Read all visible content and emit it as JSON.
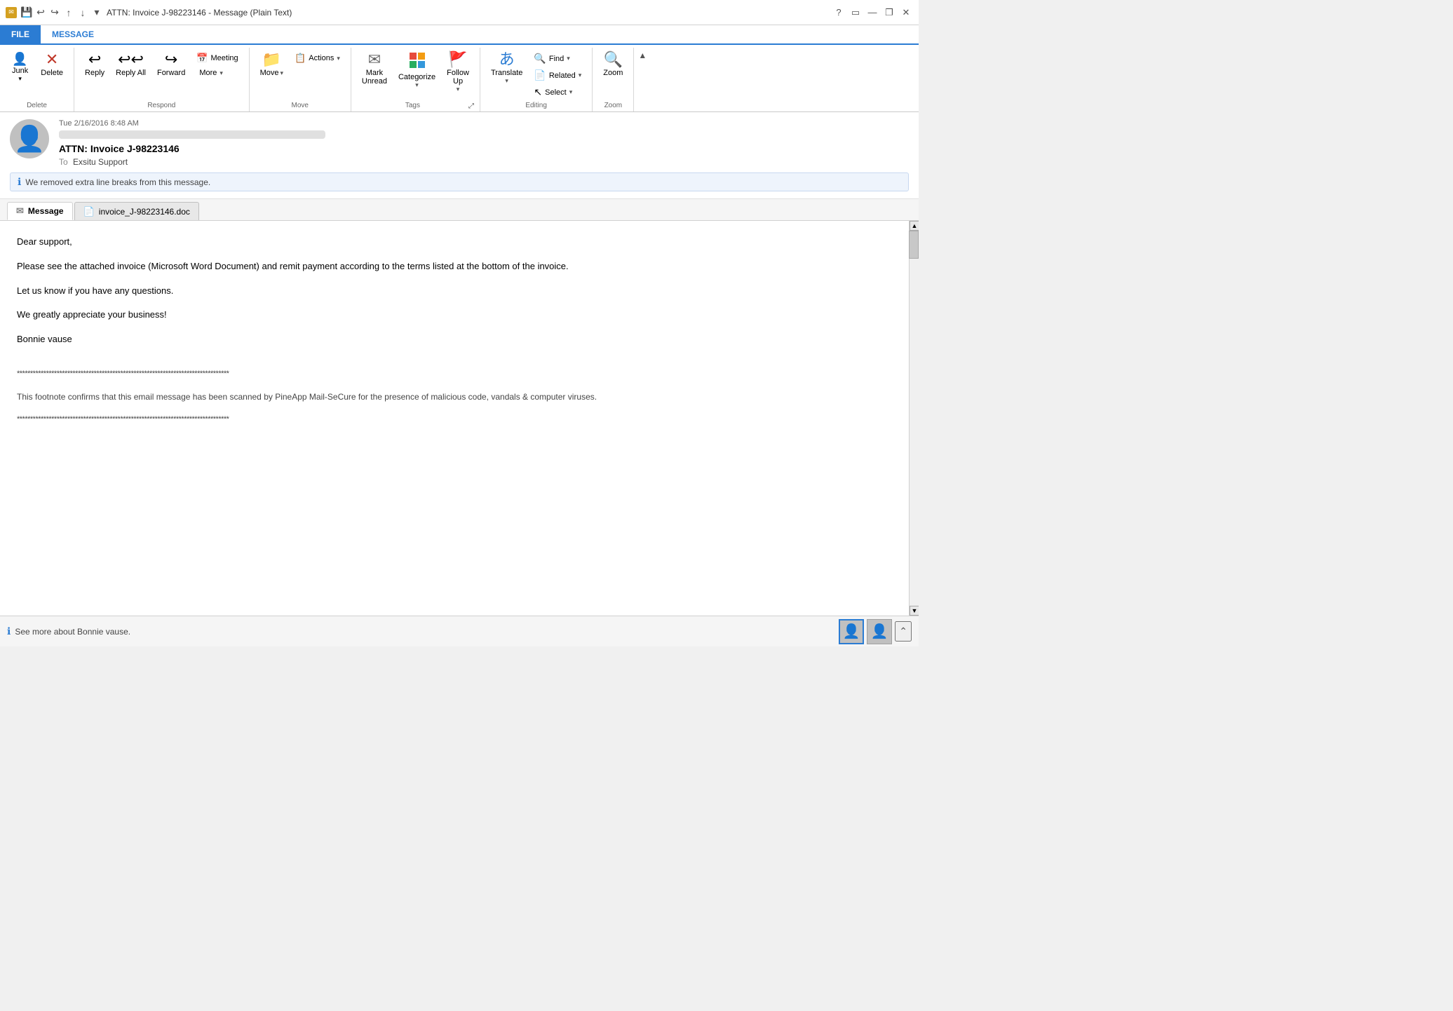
{
  "window": {
    "title": "ATTN: Invoice J-98223146 - Message (Plain Text)"
  },
  "titlebar": {
    "save_icon": "💾",
    "undo_icon": "↩",
    "redo_icon": "↪",
    "up_icon": "↑",
    "down_icon": "↓",
    "help_icon": "?",
    "minimize_icon": "—",
    "restore_icon": "❐",
    "close_icon": "✕"
  },
  "ribbon": {
    "tabs": [
      {
        "label": "FILE",
        "active": false
      },
      {
        "label": "MESSAGE",
        "active": true
      }
    ],
    "groups": {
      "delete": {
        "label": "Delete",
        "junk_label": "Junk",
        "delete_label": "Delete"
      },
      "respond": {
        "label": "Respond",
        "reply_label": "Reply",
        "reply_all_label": "Reply All",
        "forward_label": "Forward",
        "meeting_label": "Meeting",
        "more_label": "More"
      },
      "move": {
        "label": "Move",
        "move_label": "Move",
        "actions_label": "Actions"
      },
      "tags": {
        "label": "Tags",
        "mark_unread_label": "Mark\nUnread",
        "categorize_label": "Categorize",
        "followup_label": "Follow\nUp",
        "tags_launcher": "⤢"
      },
      "editing": {
        "label": "Editing",
        "translate_label": "Translate",
        "find_label": "Find",
        "related_label": "Related",
        "select_label": "Select"
      },
      "zoom": {
        "label": "Zoom",
        "zoom_label": "Zoom"
      }
    }
  },
  "email": {
    "date": "Tue 2/16/2016 8:48 AM",
    "subject": "ATTN: Invoice J-98223146",
    "to_label": "To",
    "to": "Exsitu Support",
    "info_message": "We removed extra line breaks from this message.",
    "tabs": [
      {
        "label": "Message",
        "active": true,
        "type": "message"
      },
      {
        "label": "invoice_J-98223146.doc",
        "active": false,
        "type": "doc"
      }
    ],
    "body": {
      "greeting": "Dear support,",
      "para1": "Please see the attached invoice (Microsoft Word Document) and remit payment according to the terms listed at the bottom of the invoice.",
      "para2": "Let us know if you have any questions.",
      "para3": "We greatly appreciate your business!",
      "signature": "Bonnie vause",
      "footnote_line": "********************************************************************************",
      "footnote_text": "This footnote confirms that this email message has been scanned by PineApp Mail-SeCure for the presence of malicious code, vandals & computer viruses.",
      "footnote_line2": "********************************************************************************"
    }
  },
  "bottombar": {
    "info_text": "See more about Bonnie vause.",
    "expand_icon": "⌃"
  }
}
